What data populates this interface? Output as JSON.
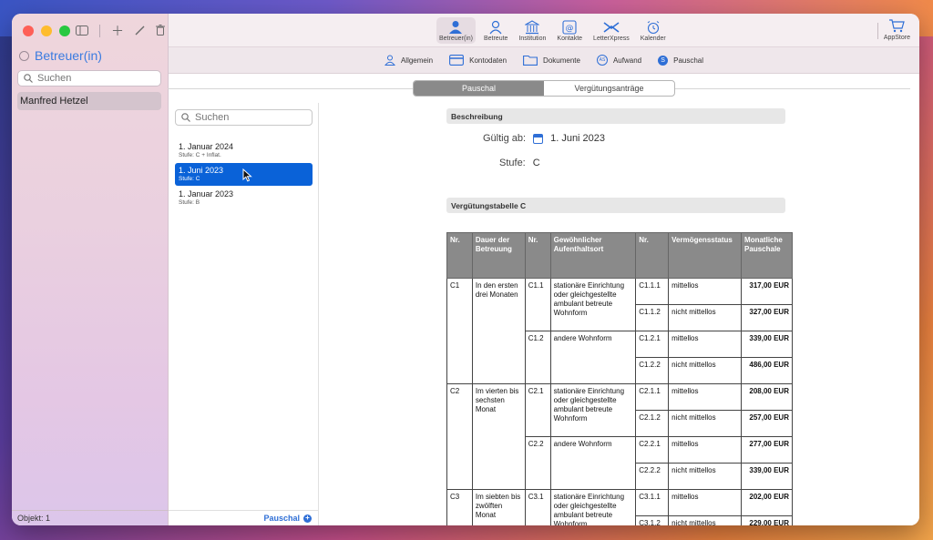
{
  "sidebar": {
    "title": "Betreuer(in)",
    "search_placeholder": "Suchen",
    "items": [
      {
        "label": "Manfred Hetzel"
      }
    ],
    "footer": "Objekt: 1"
  },
  "toolbar": {
    "items": [
      {
        "label": "Betreuer(in)",
        "icon": "person-pair-icon",
        "active": true
      },
      {
        "label": "Betreute",
        "icon": "person-icon"
      },
      {
        "label": "Institution",
        "icon": "bank-icon"
      },
      {
        "label": "Kontakte",
        "icon": "at-contact-icon"
      },
      {
        "label": "LetterXpress",
        "icon": "letterxpress-icon"
      },
      {
        "label": "Kalender",
        "icon": "alarm-clock-icon"
      }
    ],
    "appstore": "AppStore"
  },
  "subtabs": [
    {
      "label": "Allgemein"
    },
    {
      "label": "Kontodaten"
    },
    {
      "label": "Dokumente"
    },
    {
      "label": "Aufwand",
      "badge": "AS"
    },
    {
      "label": "Pauschal",
      "badge": "S"
    }
  ],
  "segmented": {
    "options": [
      "Pauschal",
      "Vergütungsanträge"
    ],
    "selected": "Pauschal"
  },
  "list": {
    "search_placeholder": "Suchen",
    "items": [
      {
        "title": "1. Januar 2024",
        "subtitle": "Stufe: C + Inflat."
      },
      {
        "title": "1. Juni 2023",
        "subtitle": "Stufe: C",
        "selected": true
      },
      {
        "title": "1. Januar 2023",
        "subtitle": "Stufe: B"
      }
    ],
    "footer_button": "Pauschal"
  },
  "detail": {
    "beschreibung_header": "Beschreibung",
    "gueltig_label": "Gültig ab:",
    "gueltig_value": "1. Juni 2023",
    "stufe_label": "Stufe:",
    "stufe_value": "C",
    "table_header": "Vergütungstabelle C",
    "columns": [
      "Nr.",
      "Dauer der Betreuung",
      "Nr.",
      "Gewöhnlicher Aufenthaltsort",
      "Nr.",
      "Vermögensstatus",
      "Monatliche Pauschale"
    ],
    "groups": [
      {
        "nr": "C1",
        "dauer": "In den ersten drei Monaten",
        "subs": [
          {
            "nr": "C1.1",
            "ort": "stationäre Einrichtung oder gleichgestellte ambulant betreute Wohnform",
            "rows": [
              {
                "nr": "C1.1.1",
                "status": "mittellos",
                "amount": "317,00 EUR"
              },
              {
                "nr": "C1.1.2",
                "status": "nicht mittellos",
                "amount": "327,00 EUR"
              }
            ]
          },
          {
            "nr": "C1.2",
            "ort": "andere Wohnform",
            "rows": [
              {
                "nr": "C1.2.1",
                "status": "mittellos",
                "amount": "339,00 EUR"
              },
              {
                "nr": "C1.2.2",
                "status": "nicht mittellos",
                "amount": "486,00 EUR"
              }
            ]
          }
        ]
      },
      {
        "nr": "C2",
        "dauer": "Im vierten bis sechsten Monat",
        "subs": [
          {
            "nr": "C2.1",
            "ort": "stationäre Einrichtung oder gleichgestellte ambulant betreute Wohnform",
            "rows": [
              {
                "nr": "C2.1.1",
                "status": "mittellos",
                "amount": "208,00 EUR"
              },
              {
                "nr": "C2.1.2",
                "status": "nicht mittellos",
                "amount": "257,00 EUR"
              }
            ]
          },
          {
            "nr": "C2.2",
            "ort": "andere Wohnform",
            "rows": [
              {
                "nr": "C2.2.1",
                "status": "mittellos",
                "amount": "277,00 EUR"
              },
              {
                "nr": "C2.2.2",
                "status": "nicht mittellos",
                "amount": "339,00 EUR"
              }
            ]
          }
        ]
      },
      {
        "nr": "C3",
        "dauer": "Im siebten bis zwölften Monat",
        "subs": [
          {
            "nr": "C3.1",
            "ort": "stationäre Einrichtung oder gleichgestellte ambulant betreute Wohnform",
            "rows": [
              {
                "nr": "C3.1.1",
                "status": "mittellos",
                "amount": "202,00 EUR"
              },
              {
                "nr": "C3.1.2",
                "status": "nicht mittellos",
                "amount": "229,00 EUR"
              }
            ]
          }
        ]
      }
    ]
  },
  "colors": {
    "accent": "#2f6fd6",
    "selection": "#0a62d8",
    "table_header": "#8a8a8a"
  }
}
